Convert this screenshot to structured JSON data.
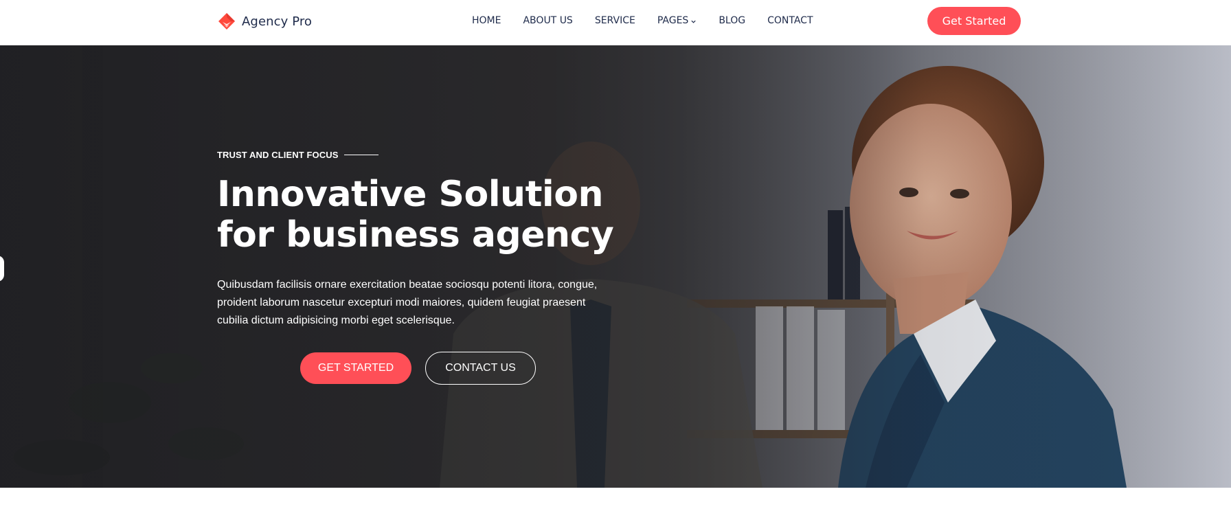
{
  "header": {
    "brand": "Agency Pro",
    "logo_icon": "diamond-logo-icon",
    "nav": [
      {
        "label": "HOME",
        "name": "nav-home"
      },
      {
        "label": "ABOUT US",
        "name": "nav-about-us"
      },
      {
        "label": "SERVICE",
        "name": "nav-service"
      },
      {
        "label": "PAGES",
        "name": "nav-pages",
        "has_dropdown": true
      },
      {
        "label": "BLOG",
        "name": "nav-blog"
      },
      {
        "label": "CONTACT",
        "name": "nav-contact"
      }
    ],
    "cta_label": "Get Started"
  },
  "hero": {
    "eyebrow": "TRUST AND CLIENT FOCUS",
    "title": "Innovative Solution for business agency",
    "description": "Quibusdam facilisis ornare exercitation beatae sociosqu potenti litora, congue, proident laborum nascetur excepturi modi maiores, quidem feugiat praesent cubilia dictum adipisicing morbi eget scelerisque.",
    "primary_button": "GET STARTED",
    "secondary_button": "CONTACT US",
    "background_image": "office-businesswoman-photo"
  },
  "colors": {
    "accent": "#ff4f57",
    "nav_text": "#1e2a4a",
    "hero_overlay": "#2b2c31"
  }
}
